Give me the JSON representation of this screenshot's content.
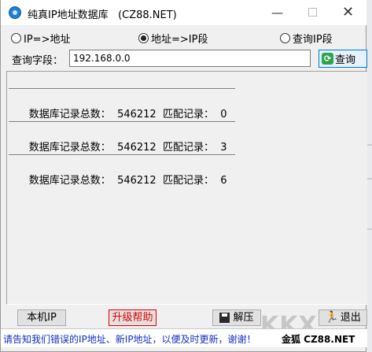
{
  "window": {
    "title": "纯真IP地址数据库   (CZ88.NET)",
    "minimize_glyph": "—",
    "maximize_glyph": "☐",
    "close_glyph": "✕"
  },
  "modes": [
    {
      "label": "IP=>地址",
      "selected": false
    },
    {
      "label": "地址=>IP段",
      "selected": true
    },
    {
      "label": "查询IP段",
      "selected": false
    }
  ],
  "query": {
    "label": "查询字段：",
    "value": "192.168.0.0",
    "button_label": "查询",
    "button_icon": "refresh-icon"
  },
  "results": [
    {
      "total_label": "数据库记录总数：",
      "total": "546212",
      "match_label": "匹配记录：",
      "match": "0"
    },
    {
      "total_label": "数据库记录总数：",
      "total": "546212",
      "match_label": "匹配记录：",
      "match": "3"
    },
    {
      "total_label": "数据库记录总数：",
      "total": "546212",
      "match_label": "匹配记录：",
      "match": "6"
    }
  ],
  "buttons": {
    "local_ip": "本机IP",
    "upgrade_help": "升级帮助",
    "unzip": "解压",
    "exit": "退出"
  },
  "status": {
    "message": "请告知我们错误的IP地址、新IP地址，以便及时更新，谢谢！",
    "brand": "金狐 CZ88.NET"
  },
  "watermark": "KKX",
  "colors": {
    "upgrade_text": "#e00000",
    "status_text": "#1030c0",
    "query_button_border": "#0078d7"
  }
}
